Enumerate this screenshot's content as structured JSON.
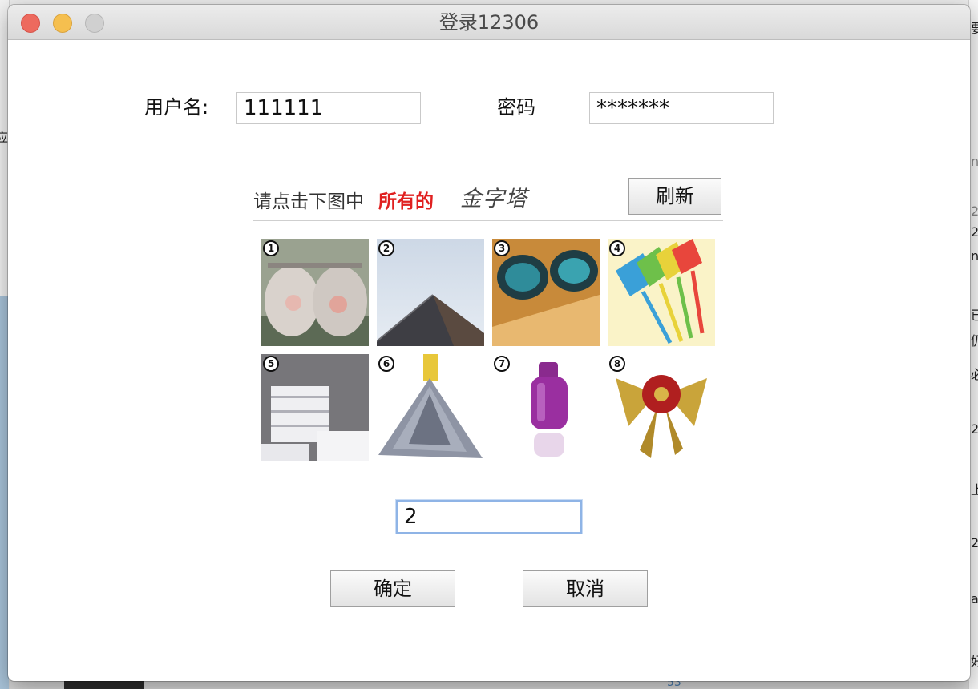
{
  "window": {
    "title": "登录12306"
  },
  "form": {
    "username_label": "用户名:",
    "username_value": "111111",
    "password_label": "密码",
    "password_value": "*******"
  },
  "captcha": {
    "instruction": "请点击下图中",
    "instruction_highlight": "所有的",
    "keyword": "金字塔",
    "refresh_label": "刷新",
    "tiles": [
      {
        "number": "1",
        "subject": "ceramic-jars"
      },
      {
        "number": "2",
        "subject": "pyramid"
      },
      {
        "number": "3",
        "subject": "teal-bowls"
      },
      {
        "number": "4",
        "subject": "fly-swatters"
      },
      {
        "number": "5",
        "subject": "tape-rolls"
      },
      {
        "number": "6",
        "subject": "mop-head"
      },
      {
        "number": "7",
        "subject": "hot-water-bottle"
      },
      {
        "number": "8",
        "subject": "gold-bow-ornament"
      }
    ],
    "answer_value": "2"
  },
  "actions": {
    "confirm_label": "确定",
    "cancel_label": "取消"
  },
  "background": {
    "right_glyphs": [
      "要",
      "n",
      "2",
      "2",
      "nd",
      "已",
      "仍",
      "必",
      "2",
      "上",
      "2",
      "a",
      "好"
    ],
    "left_glyph": "应",
    "bottom_number": "53"
  },
  "colors": {
    "highlight": "#e02020",
    "focus_ring": "#8fb4e6",
    "close": "#ed6a5e",
    "minimize": "#f5bf4f"
  }
}
